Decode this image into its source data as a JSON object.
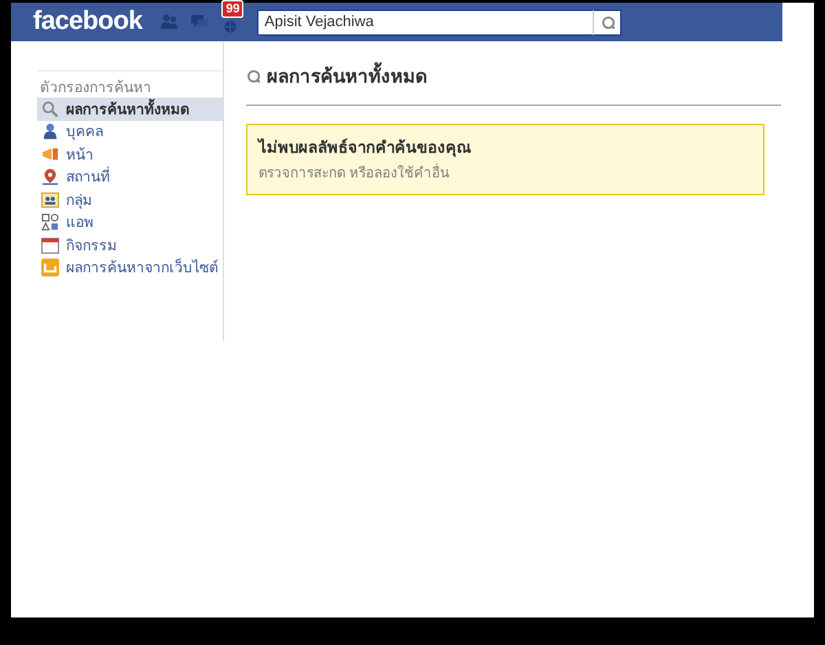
{
  "header": {
    "logo": "facebook",
    "notifications_badge": "99",
    "search": {
      "value": "Apisit Vejachiwa"
    }
  },
  "sidebar": {
    "title": "ตัวกรองการค้นหา",
    "items": [
      {
        "label": "ผลการค้นหาทั้งหมด",
        "kind": "all",
        "selected": true
      },
      {
        "label": "บุคคล",
        "kind": "people",
        "selected": false
      },
      {
        "label": "หน้า",
        "kind": "pages",
        "selected": false
      },
      {
        "label": "สถานที่",
        "kind": "places",
        "selected": false
      },
      {
        "label": "กลุ่ม",
        "kind": "groups",
        "selected": false
      },
      {
        "label": "แอพ",
        "kind": "apps",
        "selected": false
      },
      {
        "label": "กิจกรรม",
        "kind": "events",
        "selected": false
      },
      {
        "label": "ผลการค้นหาจากเว็บไซต์",
        "kind": "web",
        "selected": false
      }
    ]
  },
  "main": {
    "heading": "ผลการค้นหาทั้งหมด",
    "notice": {
      "title": "ไม่พบผลลัพธ์จากคำค้นของคุณ",
      "message": "ตรวจการสะกด หรือลองใช้คำอื่น"
    }
  }
}
